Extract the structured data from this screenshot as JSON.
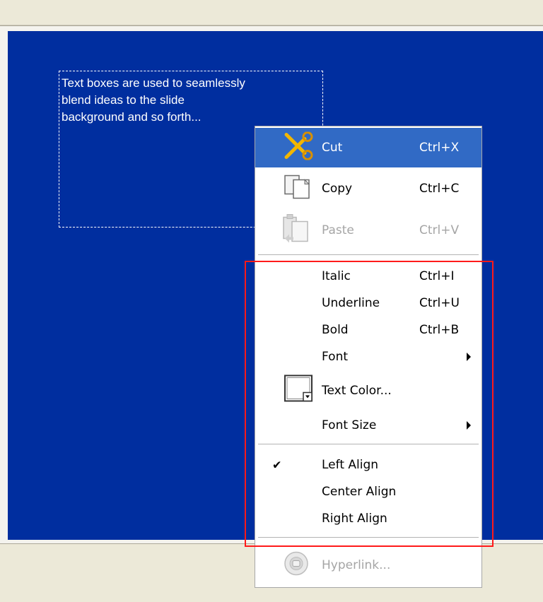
{
  "slide": {
    "text": "Text boxes are used to seamlessly\nblend ideas to the slide\nbackground and so forth..."
  },
  "colors": {
    "slide_background": "#002e9f",
    "menu_highlight": "#316ac5",
    "annotation_outline": "#ff1a1a"
  },
  "menu": {
    "cut": {
      "label": "Cut",
      "shortcut": "Ctrl+X",
      "icon": "scissors-icon"
    },
    "copy": {
      "label": "Copy",
      "shortcut": "Ctrl+C",
      "icon": "copy-icon"
    },
    "paste": {
      "label": "Paste",
      "shortcut": "Ctrl+V",
      "icon": "paste-icon"
    },
    "italic": {
      "label": "Italic",
      "shortcut": "Ctrl+I"
    },
    "underline": {
      "label": "Underline",
      "shortcut": "Ctrl+U"
    },
    "bold": {
      "label": "Bold",
      "shortcut": "Ctrl+B"
    },
    "font": {
      "label": "Font"
    },
    "text_color": {
      "label": "Text Color...",
      "icon": "color-swatch-icon"
    },
    "font_size": {
      "label": "Font Size"
    },
    "left_align": {
      "label": "Left Align",
      "checked": true
    },
    "center_align": {
      "label": "Center Align"
    },
    "right_align": {
      "label": "Right Align"
    },
    "hyperlink": {
      "label": "Hyperlink...",
      "icon": "hyperlink-globe-icon"
    }
  }
}
